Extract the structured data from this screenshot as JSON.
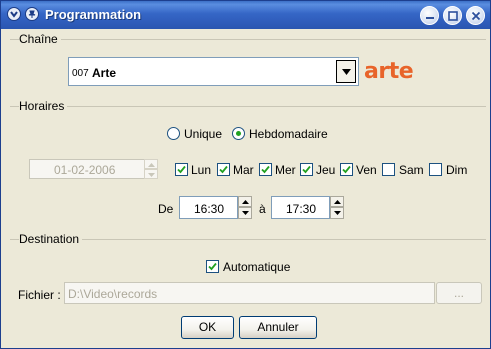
{
  "window": {
    "title": "Programmation"
  },
  "chaine": {
    "group_label": "Chaîne",
    "selected_number": "007",
    "selected_name": "Arte",
    "logo_text": "arte",
    "logo_color": "#e8642a"
  },
  "horaires": {
    "group_label": "Horaires",
    "mode_options": [
      {
        "label": "Unique",
        "selected": false
      },
      {
        "label": "Hebdomadaire",
        "selected": true
      }
    ],
    "date_value": "01-02-2006",
    "days": [
      {
        "label": "Lun",
        "checked": true
      },
      {
        "label": "Mar",
        "checked": true
      },
      {
        "label": "Mer",
        "checked": true
      },
      {
        "label": "Jeu",
        "checked": true
      },
      {
        "label": "Ven",
        "checked": true
      },
      {
        "label": "Sam",
        "checked": false
      },
      {
        "label": "Dim",
        "checked": false
      }
    ],
    "from_label": "De",
    "from_time": "16:30",
    "to_label": "à",
    "to_time": "17:30"
  },
  "destination": {
    "group_label": "Destination",
    "auto_label": "Automatique",
    "auto_checked": true,
    "file_label": "Fichier :",
    "file_path": "D:\\Video\\records",
    "browse_label": "..."
  },
  "buttons": {
    "ok": "OK",
    "cancel": "Annuler"
  }
}
